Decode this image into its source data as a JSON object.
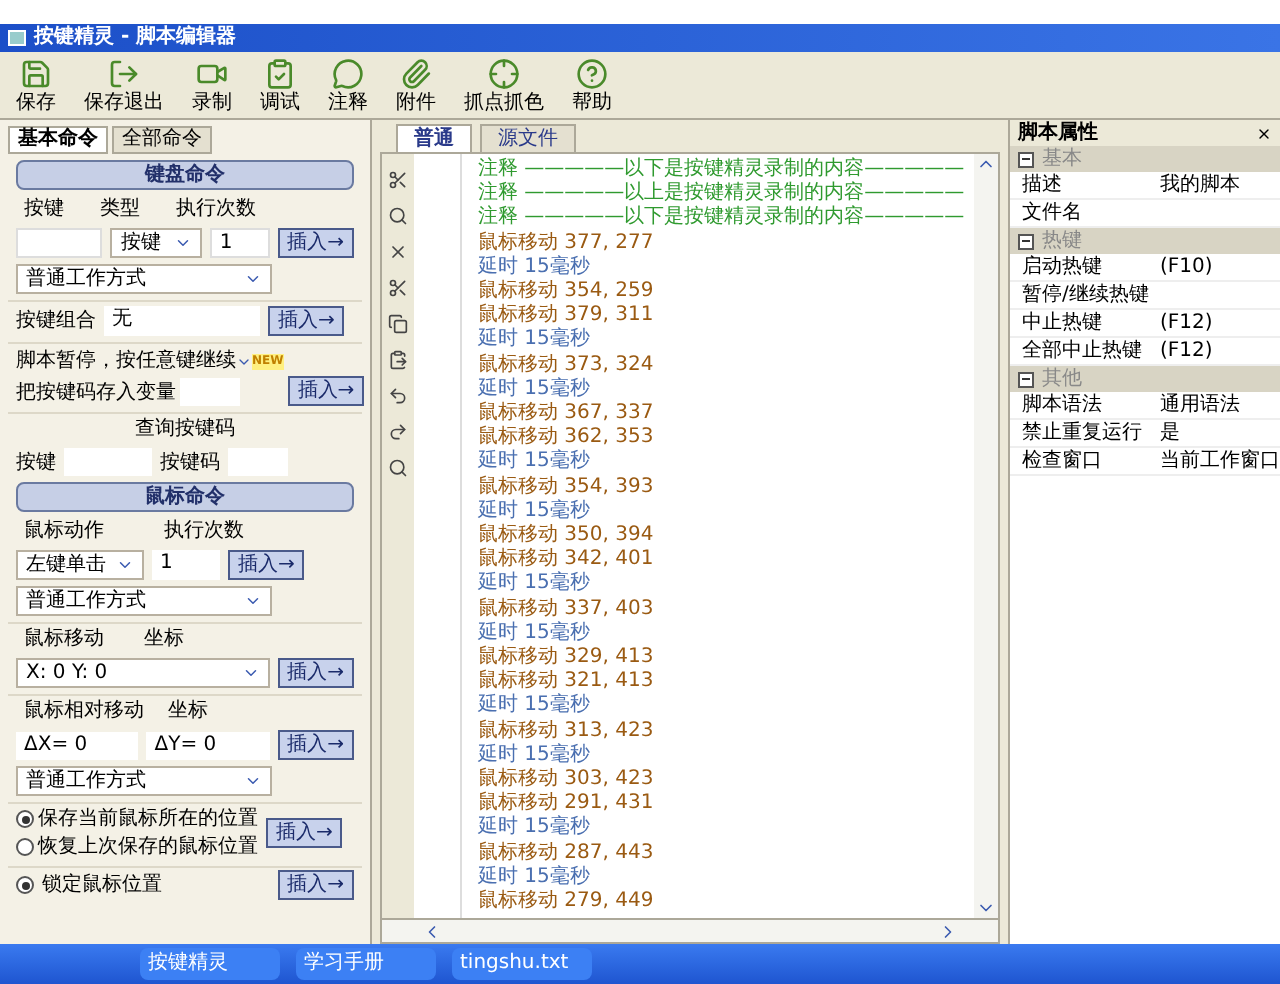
{
  "window": {
    "title": "按键精灵 - 脚本编辑器"
  },
  "toolbar": [
    {
      "label": "保存"
    },
    {
      "label": "保存退出"
    },
    {
      "label": "录制"
    },
    {
      "label": "调试"
    },
    {
      "label": "注释"
    },
    {
      "label": "附件"
    },
    {
      "label": "抓点抓色"
    },
    {
      "label": "帮助"
    }
  ],
  "left_panel": {
    "tabs": [
      {
        "label": "基本命令",
        "selected": true
      },
      {
        "label": "全部命令",
        "selected": false
      }
    ],
    "keyboard": {
      "title": "键盘命令",
      "key_label": "按键",
      "type_label": "类型",
      "count_label": "执行次数",
      "type_value": "按键",
      "count_value": "1",
      "mode": "普通工作方式",
      "insert": "插入→",
      "combo_label": "按键组合",
      "combo_value": "无",
      "combo_insert": "插入→",
      "pause_value": "脚本暂停，按任意键继续",
      "pause_badge": "NEW",
      "store_label": "把按键码存入变量",
      "pause_insert": "插入→",
      "query_title": "查询按键码",
      "query_key": "按键",
      "query_code": "按键码"
    },
    "mouse": {
      "title": "鼠标命令",
      "action_label": "鼠标动作",
      "count_label": "执行次数",
      "action_value": "左键单击",
      "count_value": "1",
      "mode": "普通工作方式",
      "insert": "插入→",
      "move_label": "鼠标移动",
      "move_coord": "坐标",
      "move_value": "X: 0  Y: 0",
      "move_insert": "插入→",
      "rel_label": "鼠标相对移动",
      "rel_coord": "坐标",
      "dx": "ΔX= 0",
      "dy": "ΔY= 0",
      "rel_mode": "普通工作方式",
      "rel_insert": "插入→",
      "radios": [
        {
          "label": "保存当前鼠标所在的位置",
          "selected": true
        },
        {
          "label": "恢复上次保存的鼠标位置",
          "selected": false
        }
      ],
      "radio_insert": "插入→",
      "lock": {
        "label": "锁定鼠标位置",
        "selected": true
      },
      "lock_insert": "插入→"
    }
  },
  "editor": {
    "tabs": [
      {
        "label": "普通",
        "selected": true
      },
      {
        "label": "源文件",
        "selected": false
      }
    ],
    "lines": [
      {
        "kind": "comment",
        "text": "注释 —————以下是按键精灵录制的内容—————"
      },
      {
        "kind": "comment",
        "text": "注释 —————以上是按键精灵录制的内容—————"
      },
      {
        "kind": "comment",
        "text": "注释 —————以下是按键精灵录制的内容—————"
      },
      {
        "kind": "move",
        "text": "鼠标移动 377, 277"
      },
      {
        "kind": "delay",
        "text": "延时 15毫秒"
      },
      {
        "kind": "move",
        "text": "鼠标移动 354, 259"
      },
      {
        "kind": "move",
        "text": "鼠标移动 379, 311"
      },
      {
        "kind": "delay",
        "text": "延时 15毫秒"
      },
      {
        "kind": "move",
        "text": "鼠标移动 373, 324"
      },
      {
        "kind": "delay",
        "text": "延时 15毫秒"
      },
      {
        "kind": "move",
        "text": "鼠标移动 367, 337"
      },
      {
        "kind": "move",
        "text": "鼠标移动 362, 353"
      },
      {
        "kind": "delay",
        "text": "延时 15毫秒"
      },
      {
        "kind": "move",
        "text": "鼠标移动 354, 393"
      },
      {
        "kind": "delay",
        "text": "延时 15毫秒"
      },
      {
        "kind": "move",
        "text": "鼠标移动 350, 394"
      },
      {
        "kind": "move",
        "text": "鼠标移动 342, 401"
      },
      {
        "kind": "delay",
        "text": "延时 15毫秒"
      },
      {
        "kind": "move",
        "text": "鼠标移动 337, 403"
      },
      {
        "kind": "delay",
        "text": "延时 15毫秒"
      },
      {
        "kind": "move",
        "text": "鼠标移动 329, 413"
      },
      {
        "kind": "move",
        "text": "鼠标移动 321, 413"
      },
      {
        "kind": "delay",
        "text": "延时 15毫秒"
      },
      {
        "kind": "move",
        "text": "鼠标移动 313, 423"
      },
      {
        "kind": "delay",
        "text": "延时 15毫秒"
      },
      {
        "kind": "move",
        "text": "鼠标移动 303, 423"
      },
      {
        "kind": "move",
        "text": "鼠标移动 291, 431"
      },
      {
        "kind": "delay",
        "text": "延时 15毫秒"
      },
      {
        "kind": "move",
        "text": "鼠标移动 287, 443"
      },
      {
        "kind": "delay",
        "text": "延时 15毫秒"
      },
      {
        "kind": "move",
        "text": "鼠标移动 279, 449"
      }
    ]
  },
  "properties": {
    "title": "脚本属性",
    "groups": [
      {
        "name": "基本",
        "expanded": true,
        "rows": [
          {
            "key": "描述",
            "value": "我的脚本"
          },
          {
            "key": "文件名"
          }
        ]
      },
      {
        "name": "热键",
        "expanded": true,
        "rows": [
          {
            "key": "启动热键",
            "value": "(F10)"
          },
          {
            "key": "暂停/继续热键"
          },
          {
            "key": "中止热键",
            "value": "(F12)"
          },
          {
            "key": "全部中止热键",
            "value": "(F12)"
          }
        ]
      },
      {
        "name": "其他",
        "expanded": true,
        "rows": [
          {
            "key": "脚本语法",
            "value": "通用语法"
          },
          {
            "key": "禁止重复运行",
            "value": "是"
          },
          {
            "key": "检查窗口",
            "value": "当前工作窗口"
          }
        ]
      }
    ]
  },
  "taskbar": [
    {
      "label": "按键精灵"
    },
    {
      "label": "学习手册"
    },
    {
      "label": "tingshu.txt"
    }
  ]
}
